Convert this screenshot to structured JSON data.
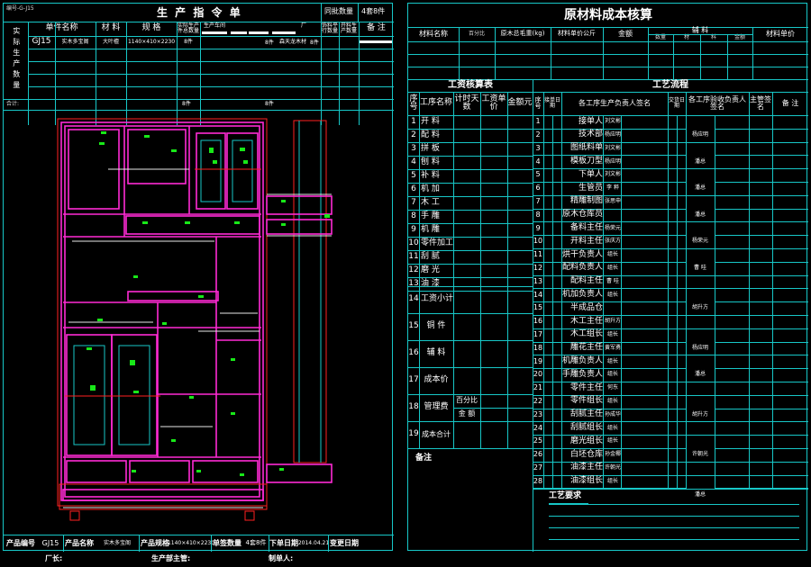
{
  "left_sheet": {
    "title": "生 产 指 令 单",
    "order_code": "编号-G-J15",
    "sidebar_label": "实际生产数量",
    "total_label": "合计:",
    "header": {
      "unit_name": "单件名称",
      "material": "材 料",
      "spec": "规 格",
      "same_qty": "同批数量",
      "same_qty_value": "4套8件",
      "sub_h1": "实际生产件总数量",
      "sub_h2": "生产车间",
      "sub_h3": "厂",
      "sub_h4": "饰料平行数量",
      "sub_h5": "开料生产数量",
      "remarks": "备 注"
    },
    "row1": {
      "code": "GJ15",
      "name": "实木多宝阁",
      "material": "大叶檀",
      "spec": "1140×410×2230",
      "qty": "8件",
      "qty2": "8件",
      "supplier": "森天龙木材",
      "qty3": "8件"
    },
    "totals": [
      "8件",
      "8件"
    ],
    "footer": {
      "code_label": "产品编号",
      "code_value": "GJ15",
      "name_label": "产品名称",
      "name_value": "实木多宝阁",
      "spec_label": "产品规格",
      "spec_value": "1140×410×2230",
      "batch_label": "单签数量",
      "batch_value": "4套8件",
      "date_label": "下单日期",
      "date_value": "2014.04.21",
      "change_label": "变更日期"
    },
    "bottom_factory": "厂长:",
    "bottom_manager": "生产部主管:",
    "bottom_maker": "制单人:"
  },
  "right_sheet": {
    "title": "原材料成本核算",
    "cost_header": [
      "材料名称",
      "百分比",
      "原木总毛重(kg)",
      "材料单价公斤",
      "金额",
      "辅 料",
      "材料单价"
    ],
    "aux_sub": [
      "数量",
      "材",
      "料",
      "金额"
    ],
    "wage_title": "工资核算表",
    "process_title": "工艺流程",
    "wage_header": {
      "seq": "序号",
      "process": "工序名称",
      "time": "计时天数",
      "price": "工资单价",
      "amount": "金额元"
    },
    "wage_rows": [
      "开 料",
      "配 料",
      "拼 板",
      "刨 料",
      "补 料",
      "机 加",
      "木 工",
      "手 雕",
      "机 雕",
      "零件加工",
      "刮 腻",
      "磨 光",
      "油 漆"
    ],
    "summary_rows": [
      {
        "no": "14",
        "label": "工资小计"
      },
      {
        "no": "15",
        "label": "铜 件"
      },
      {
        "no": "16",
        "label": "辅 料"
      },
      {
        "no": "17",
        "label": "成本价"
      },
      {
        "no": "18",
        "label": "管理费",
        "sub1": "百分比",
        "sub2": "金 额"
      },
      {
        "no": "19",
        "label": "成本合计"
      }
    ],
    "remarks_label": "备注",
    "process_header": {
      "seq": "序号",
      "recv": "接单日期",
      "owner": "各工序生产负责人签名",
      "handover": "交货日期",
      "inspect": "各工序验收负责人签名",
      "supervisor": "主管签名",
      "remarks": "备 注"
    },
    "process_rows": [
      {
        "no": "1",
        "role": "接单人",
        "name": "刘文彬"
      },
      {
        "no": "2",
        "role": "技术部",
        "name": "杨应明"
      },
      {
        "no": "3",
        "role": "图纸料单",
        "name": "刘文彬"
      },
      {
        "no": "4",
        "role": "模板刀型",
        "name": "杨应明"
      },
      {
        "no": "5",
        "role": "下单人",
        "name": "刘文彬"
      },
      {
        "no": "6",
        "role": "生管员",
        "name": "李 粹"
      },
      {
        "no": "7",
        "role": "精雕制图",
        "name": "张思申"
      },
      {
        "no": "8",
        "role": "原木仓库员",
        "name": ""
      },
      {
        "no": "9",
        "role": "备料主任",
        "name": "杨荣元"
      },
      {
        "no": "10",
        "role": "开料主任",
        "name": "张庆方"
      },
      {
        "no": "11",
        "role": "烘干负责人",
        "name": "组长"
      },
      {
        "no": "12",
        "role": "配料负责人",
        "name": "组长"
      },
      {
        "no": "13",
        "role": "配料主任",
        "name": "曹 哇"
      },
      {
        "no": "14",
        "role": "机加负责人",
        "name": "组长"
      },
      {
        "no": "15",
        "role": "半成品仓",
        "name": ""
      },
      {
        "no": "16",
        "role": "木工主任",
        "name": "胡升方"
      },
      {
        "no": "17",
        "role": "木工组长",
        "name": "组长"
      },
      {
        "no": "18",
        "role": "雕花主任",
        "name": "黄军勇"
      },
      {
        "no": "19",
        "role": "机雕负责人",
        "name": "组长"
      },
      {
        "no": "20",
        "role": "手雕负责人",
        "name": "组长"
      },
      {
        "no": "21",
        "role": "零件主任",
        "name": "何东"
      },
      {
        "no": "22",
        "role": "零件组长",
        "name": "组长"
      },
      {
        "no": "23",
        "role": "刮腻主任",
        "name": "孙成华"
      },
      {
        "no": "24",
        "role": "刮腻组长",
        "name": "组长"
      },
      {
        "no": "25",
        "role": "磨光组长",
        "name": "组长"
      },
      {
        "no": "26",
        "role": "白坯仓库",
        "name": "孙金椰"
      },
      {
        "no": "27",
        "role": "油漆主任",
        "name": "许朝光"
      },
      {
        "no": "28",
        "role": "油漆组长",
        "name": "组长"
      }
    ],
    "inspectors": [
      {
        "name": "杨应明",
        "row": 1
      },
      {
        "name": "潘总",
        "row": 3
      },
      {
        "name": "潘总",
        "row": 5
      },
      {
        "name": "潘总",
        "row": 7
      },
      {
        "name": "杨荣元",
        "row": 9
      },
      {
        "name": "曹 哇",
        "row": 11
      },
      {
        "name": "胡升方",
        "row": 14
      },
      {
        "name": "杨应明",
        "row": 17
      },
      {
        "name": "潘总",
        "row": 19
      },
      {
        "name": "胡升方",
        "row": 22
      },
      {
        "name": "许朝光",
        "row": 25
      },
      {
        "name": "潘总",
        "row": 28
      }
    ],
    "requirements_label": "工艺要求"
  }
}
